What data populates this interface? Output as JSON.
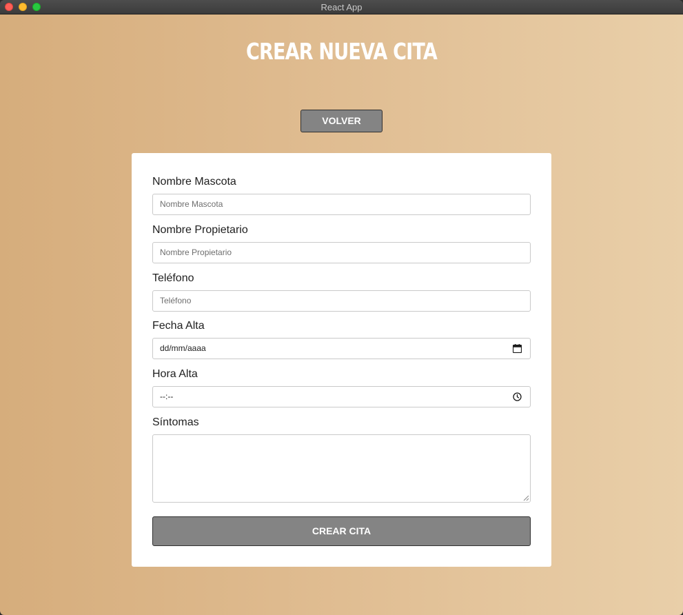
{
  "window": {
    "title": "React App"
  },
  "page": {
    "title": "CREAR NUEVA CITA",
    "back_label": "VOLVER"
  },
  "form": {
    "fields": [
      {
        "label": "Nombre Mascota",
        "placeholder": "Nombre Mascota",
        "value": ""
      },
      {
        "label": "Nombre Propietario",
        "placeholder": "Nombre Propietario",
        "value": ""
      },
      {
        "label": "Teléfono",
        "placeholder": "Teléfono",
        "value": ""
      },
      {
        "label": "Fecha Alta",
        "display": "dd/mm/aaaa",
        "icon": "calendar-icon"
      },
      {
        "label": "Hora Alta",
        "display": "--:--",
        "icon": "clock-icon"
      },
      {
        "label": "Síntomas",
        "value": ""
      }
    ],
    "submit_label": "CREAR CITA"
  },
  "colors": {
    "background_start": "#d6ad7c",
    "background_end": "#e9cfa9",
    "button": "#848484",
    "card": "#ffffff"
  }
}
